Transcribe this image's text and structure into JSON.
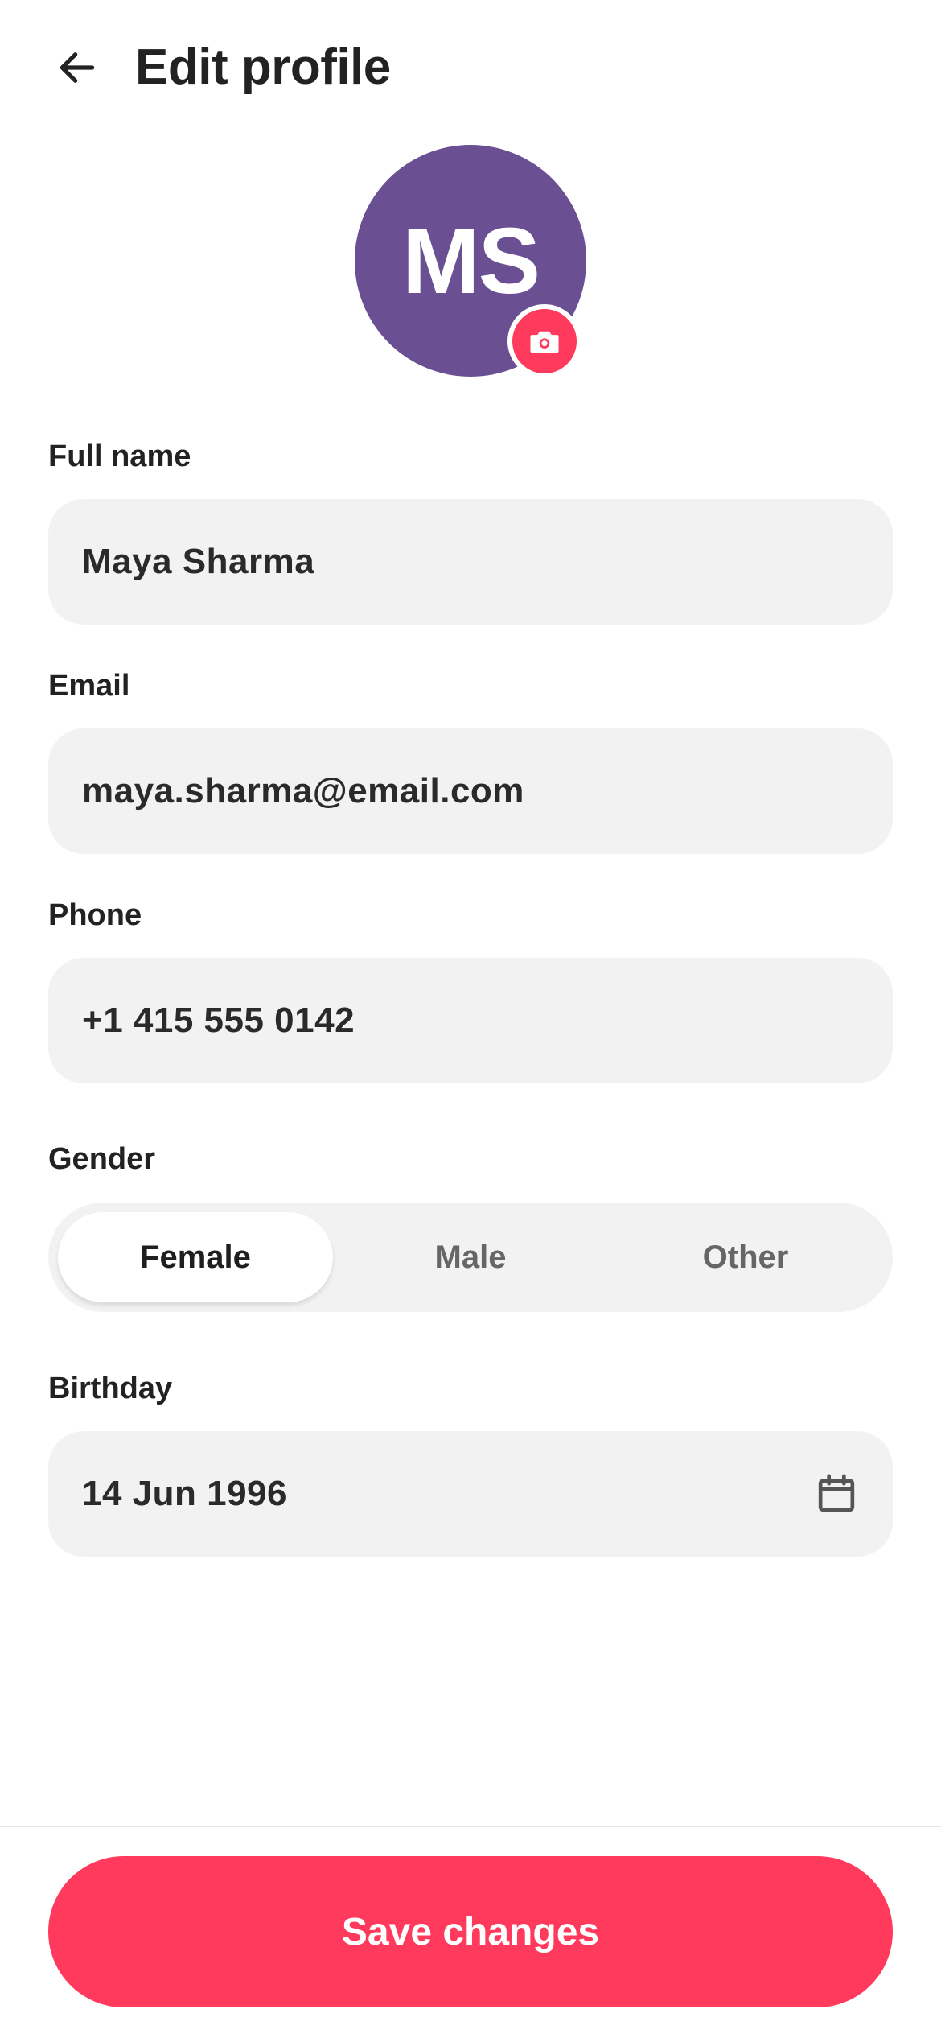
{
  "header": {
    "title": "Edit profile"
  },
  "avatar": {
    "initials": "MS",
    "background_color": "#6a4f93",
    "camera_badge_color": "#ff3a5c"
  },
  "fields": {
    "full_name": {
      "label": "Full name",
      "value": "Maya Sharma"
    },
    "email": {
      "label": "Email",
      "value": "maya.sharma@email.com"
    },
    "phone": {
      "label": "Phone",
      "value": "+1 415 555 0142"
    },
    "gender": {
      "label": "Gender",
      "options": [
        "Female",
        "Male",
        "Other"
      ],
      "selected": "Female"
    },
    "birthday": {
      "label": "Birthday",
      "value": "14 Jun 1996"
    }
  },
  "actions": {
    "save_label": "Save changes",
    "accent_color": "#ff3a5c"
  },
  "icons": {
    "back": "arrow-left-icon",
    "camera": "camera-icon",
    "calendar": "calendar-icon"
  }
}
